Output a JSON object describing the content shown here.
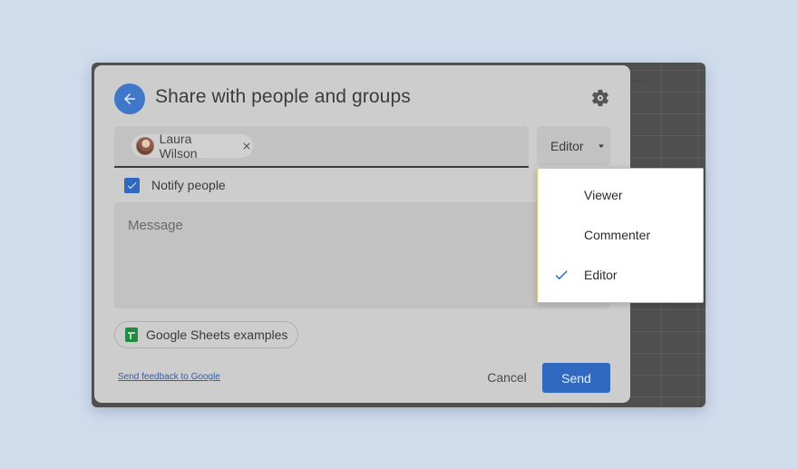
{
  "dialog": {
    "title": "Share with people and groups",
    "recipient": {
      "name": "Laura Wilson"
    },
    "role_button": {
      "label": "Editor"
    },
    "notify": {
      "label": "Notify people",
      "checked": true
    },
    "message": {
      "placeholder": "Message"
    },
    "examples_chip": {
      "label": "Google Sheets examples"
    },
    "feedback_link": "Send feedback to Google",
    "cancel_label": "Cancel",
    "send_label": "Send"
  },
  "role_menu": {
    "items": [
      {
        "label": "Viewer",
        "selected": false
      },
      {
        "label": "Commenter",
        "selected": false
      },
      {
        "label": "Editor",
        "selected": true
      }
    ]
  },
  "background": {
    "grid_dots": "..."
  },
  "icons": {
    "back": "arrow-left-icon",
    "settings": "gear-icon",
    "chip_remove": "close-icon",
    "role_caret": "caret-down-icon",
    "checkbox": "check-icon",
    "examples": "google-sheets-icon",
    "selected": "check-icon"
  },
  "colors": {
    "accent": "#2f6ac0",
    "back_button": "#3f77c9",
    "sheets_green": "#1e8e3e",
    "menu_border": "#e0c46a",
    "page_background": "#cfdcec"
  }
}
